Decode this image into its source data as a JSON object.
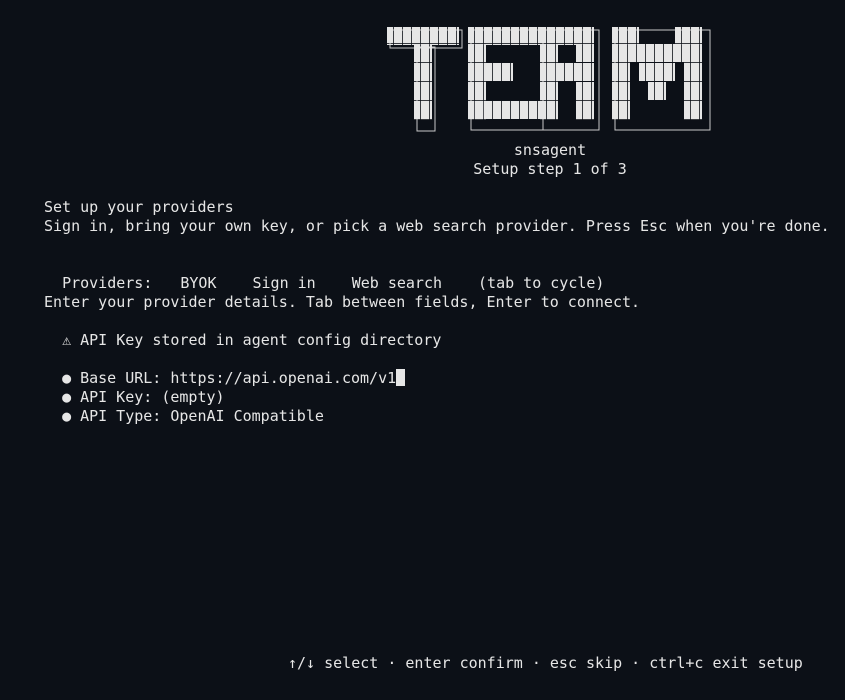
{
  "logo": {
    "text": "TERM"
  },
  "header": {
    "app_name": "snsagent",
    "step": "Setup step 1 of 3"
  },
  "intro": {
    "title": "Set up your providers",
    "subtitle": "Sign in, bring your own key, or pick a web search provider. Press Esc when you're done."
  },
  "providers": {
    "label": "Providers:",
    "tabs": [
      "BYOK",
      "Sign in",
      "Web search"
    ],
    "hint": "(tab to cycle)"
  },
  "instructions": {
    "text": "Enter your provider details. Tab between fields, Enter to connect.",
    "warning_icon": "warning-icon",
    "warning_glyph": "⚠",
    "warning_text": "API Key stored in agent config directory"
  },
  "fields": [
    {
      "bullet": "●",
      "label": "Base URL:",
      "value": "https://api.openai.com/v1"
    },
    {
      "bullet": "●",
      "label": "API Key:",
      "value": "(empty)"
    },
    {
      "bullet": "●",
      "label": "API Type:",
      "value": "OpenAI Compatible"
    }
  ],
  "footer": {
    "hint": "↑/↓ select · enter confirm · esc skip · ctrl+c exit setup"
  }
}
